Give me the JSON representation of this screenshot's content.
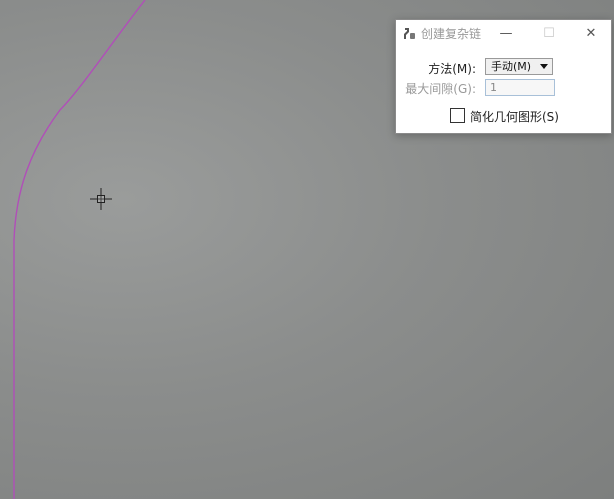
{
  "dialog": {
    "title": "创建复杂链",
    "method_label": "方法(M):",
    "method_value": "手动(M)",
    "gap_label": "最大间隙(G):",
    "gap_value": "1",
    "simplify_label": "简化几何图形(S)",
    "simplify_checked": false,
    "minimize_symbol": "—",
    "maximize_symbol": "☐",
    "close_symbol": "✕"
  },
  "canvas": {
    "curve_color": "#b04fb8",
    "cursor_color": "#222222"
  }
}
